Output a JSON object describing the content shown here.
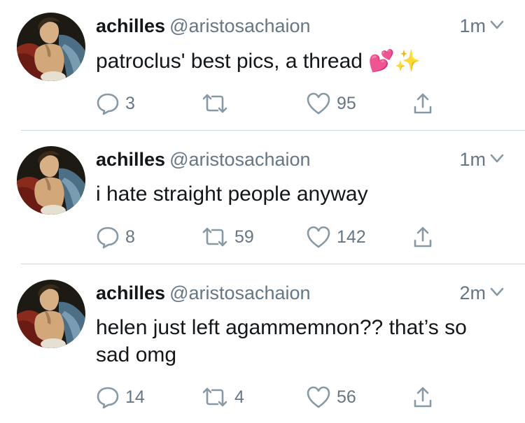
{
  "tweets": [
    {
      "display_name": "achilles",
      "handle": "@aristosachaion",
      "time": "1m",
      "text": "patroclus' best pics, a thread 💕✨",
      "reply_count": "3",
      "retweet_count": "",
      "like_count": "95"
    },
    {
      "display_name": "achilles",
      "handle": "@aristosachaion",
      "time": "1m",
      "text": "i hate straight people anyway",
      "reply_count": "8",
      "retweet_count": "59",
      "like_count": "142"
    },
    {
      "display_name": "achilles",
      "handle": "@aristosachaion",
      "time": "2m",
      "text": "helen just left agammemnon?? that’s so sad omg",
      "reply_count": "14",
      "retweet_count": "4",
      "like_count": "56"
    }
  ],
  "icons": {
    "reply": "reply-icon",
    "retweet": "retweet-icon",
    "like": "heart-icon",
    "share": "share-icon",
    "menu": "chevron-down-icon"
  },
  "colors": {
    "primary_text": "#14171a",
    "secondary_text": "#657786",
    "divider": "#ccd6dd"
  }
}
